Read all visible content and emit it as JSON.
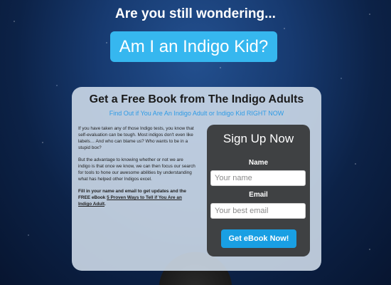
{
  "hero": {
    "headline": "Are you still wondering...",
    "cta_label": "Am I an Indigo Kid?"
  },
  "panel": {
    "title": "Get a Free Book from The Indigo Adults",
    "subtitle": "Find Out if You Are An Indigo Adult or Indigo Kid RIGHT NOW",
    "paragraph1": "If you have taken any of those Indigo tests, you know that self-evaluation can be tough. Most indigos don't even like labels… And who can blame us? Who wants to be in a stupid box?",
    "paragraph2": "But the advantage to knowing whether or not we are indigo is that once we know, we can then focus our search for tools to hone our awesome abilities by understanding what has helped other Indigos excel.",
    "paragraph3_intro": "Fill in your name and email to get updates and the FREE eBook",
    "paragraph3_link": "5 Proven Ways to Tell if You Are an Indigo Adult",
    "paragraph3_end": "."
  },
  "signup": {
    "title": "Sign Up Now",
    "name_label": "Name",
    "name_placeholder": "Your name",
    "email_label": "Email",
    "email_placeholder": "Your best email",
    "submit_label": "Get eBook Now!"
  },
  "colors": {
    "accent": "#36b7ef",
    "button": "#199fe3",
    "subtitle": "#2e9be6",
    "form_bg": "#3f4143"
  }
}
